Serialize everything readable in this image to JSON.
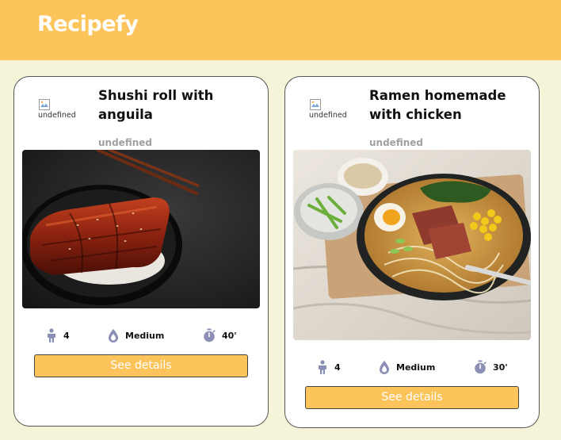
{
  "app": {
    "brand": "Recipefy"
  },
  "colors": {
    "header": "#fcc45a",
    "background": "#f5f4d8",
    "button": "#fcc45a",
    "icon": "#8b8fb5"
  },
  "recipes": [
    {
      "title": "Shushi roll with anguila",
      "image_alt": "undefined",
      "subtitle": "undefined",
      "servings": "4",
      "difficulty": "Medium",
      "time": "40'",
      "button_label": "See details",
      "icons": [
        "person-icon",
        "drop-icon",
        "timer-icon"
      ]
    },
    {
      "title": "Ramen homemade with chicken",
      "image_alt": "undefined",
      "subtitle": "undefined",
      "servings": "4",
      "difficulty": "Medium",
      "time": "30'",
      "button_label": "See details",
      "icons": [
        "person-icon",
        "drop-icon",
        "timer-icon"
      ]
    }
  ]
}
